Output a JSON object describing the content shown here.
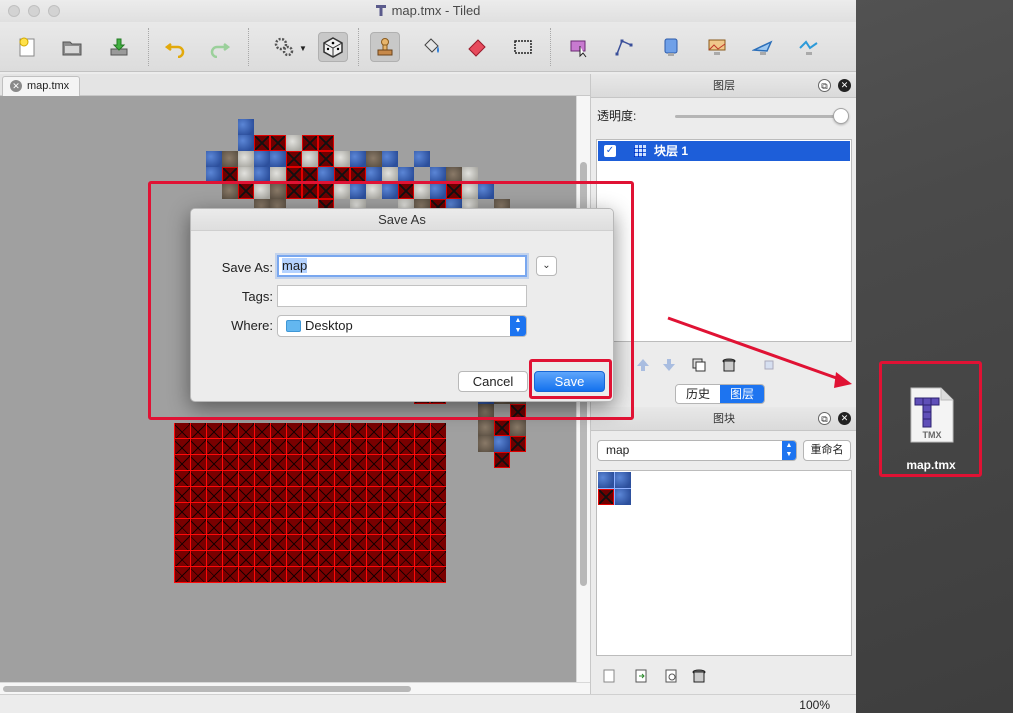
{
  "window": {
    "title": "map.tmx - Tiled"
  },
  "toolbar": {
    "tools": [
      {
        "name": "new-map"
      },
      {
        "name": "open-file"
      },
      {
        "name": "save-file"
      },
      {
        "name": "undo"
      },
      {
        "name": "redo"
      },
      {
        "name": "random-mode"
      },
      {
        "name": "terrain-dice"
      },
      {
        "name": "stamp-brush"
      },
      {
        "name": "bucket-fill"
      },
      {
        "name": "eraser"
      },
      {
        "name": "rect-select"
      },
      {
        "name": "select-objects"
      },
      {
        "name": "edit-polygons"
      },
      {
        "name": "insert-rectangle"
      },
      {
        "name": "insert-image"
      },
      {
        "name": "insert-polygon"
      },
      {
        "name": "insert-polyline"
      }
    ]
  },
  "document": {
    "tab_label": "map.tmx"
  },
  "status": {
    "zoom": "100%"
  },
  "layers_panel": {
    "title": "图层",
    "opacity_label": "透明度:",
    "opacity_value": 1.0,
    "layers": [
      {
        "name": "块层 1",
        "visible": true,
        "selected": true
      }
    ],
    "tabs": [
      {
        "label": "历史",
        "active": false
      },
      {
        "label": "图层",
        "active": true
      }
    ]
  },
  "tilesets_panel": {
    "title": "图块",
    "selected_tileset": "map",
    "rename_label": "重命名"
  },
  "save_dialog": {
    "title": "Save As",
    "save_as_label": "Save As:",
    "save_as_value": "map",
    "tags_label": "Tags:",
    "tags_value": "",
    "where_label": "Where:",
    "where_value": "Desktop",
    "cancel_label": "Cancel",
    "save_label": "Save"
  },
  "desktop": {
    "file_name": "map.tmx",
    "file_badge": "TMX"
  },
  "colors": {
    "accent": "#1d74f0",
    "selection": "#1d5ed9",
    "annotation": "#e01234"
  }
}
